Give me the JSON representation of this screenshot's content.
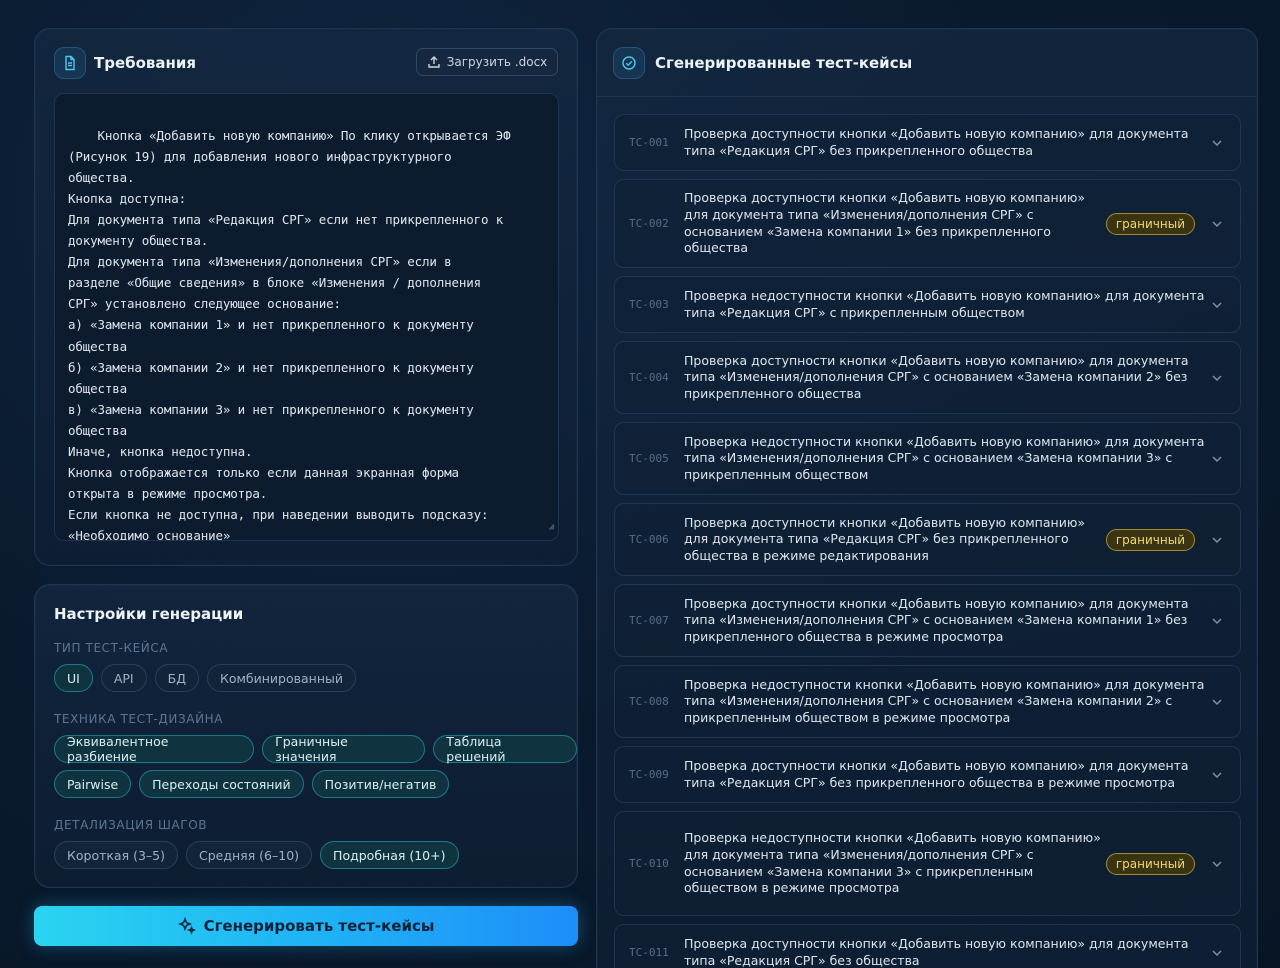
{
  "requirements": {
    "title": "Требования",
    "upload_label": "Загрузить .docx",
    "text": "Кнопка «Добавить новую компанию» По клику открывается ЭФ\n(Рисунок 19) для добавления нового инфраструктурного\nобщества.\nКнопка доступна:\nДля документа типа «Редакция СРГ» если нет прикрепленного к\nдокументу общества.\nДля документа типа «Изменения/дополнения СРГ» если в\nразделе «Общие сведения» в блоке «Изменения / дополнения\nСРГ» установлено следующее основание:\nа) «Замена компании 1» и нет прикрепленного к документу\nобщества\nб) «Замена компании 2» и нет прикрепленного к документу\nобщества\nв) «Замена компании 3» и нет прикрепленного к документу\nобщества\nИначе, кнопка недоступна.\nКнопка отображается только если данная экранная форма\nоткрыта в режиме просмотра.\nЕсли кнопка не доступна, при наведении выводить подсказу:\n«Необходимо основание»"
  },
  "settings": {
    "title": "Настройки генерации",
    "type_label": "ТИП ТЕСТ-КЕЙСА",
    "types": [
      {
        "label": "UI",
        "active": true
      },
      {
        "label": "API",
        "active": false
      },
      {
        "label": "БД",
        "active": false
      },
      {
        "label": "Комбинированный",
        "active": false
      }
    ],
    "technique_label": "ТЕХНИКА ТЕСТ-ДИЗАЙНА",
    "techniques_row1": [
      {
        "label": "Эквивалентное разбиение",
        "active": true
      },
      {
        "label": "Граничные значения",
        "active": true
      },
      {
        "label": "Таблица решений",
        "active": true
      }
    ],
    "techniques_row2": [
      {
        "label": "Pairwise",
        "active": true
      },
      {
        "label": "Переходы состояний",
        "active": true
      },
      {
        "label": "Позитив/негатив",
        "active": true
      }
    ],
    "detail_label": "ДЕТАЛИЗАЦИЯ ШАГОВ",
    "details": [
      {
        "label": "Короткая (3–5)",
        "active": false
      },
      {
        "label": "Средняя (6–10)",
        "active": false
      },
      {
        "label": "Подробная (10+)",
        "active": true
      }
    ]
  },
  "generate_label": "Сгенерировать тест-кейсы",
  "results": {
    "title": "Сгенерированные тест-кейсы",
    "badge_color": "#f2d86a",
    "accent_color": "#1fb4f5",
    "cases": [
      {
        "id": "TC-001",
        "lines": [
          "Проверка доступности кнопки «Добавить новую компанию» для документа",
          "типа «Редакция СРГ» без прикрепленного общества"
        ],
        "badge": ""
      },
      {
        "id": "TC-002",
        "lines": [
          "Проверка доступности кнопки «Добавить новую компанию»",
          "для документа типа «Изменения/дополнения СРГ» с",
          "основанием «Замена компании 1» без прикрепленного",
          "общества"
        ],
        "badge": "граничный"
      },
      {
        "id": "TC-003",
        "lines": [
          "Проверка недоступности кнопки «Добавить новую компанию» для документа",
          "типа «Редакция СРГ» с прикрепленным обществом"
        ],
        "badge": ""
      },
      {
        "id": "TC-004",
        "lines": [
          "Проверка доступности кнопки «Добавить новую компанию» для документа",
          "типа «Изменения/дополнения СРГ» с основанием «Замена компании 2» без",
          "прикрепленного общества"
        ],
        "badge": ""
      },
      {
        "id": "TC-005",
        "lines": [
          "Проверка недоступности кнопки «Добавить новую компанию» для документа",
          "типа «Изменения/дополнения СРГ» с основанием «Замена компании 3» с",
          "прикрепленным обществом"
        ],
        "badge": ""
      },
      {
        "id": "TC-006",
        "lines": [
          "Проверка доступности кнопки «Добавить новую компанию»",
          "для документа типа «Редакция СРГ» без прикрепленного",
          "общества в режиме редактирования"
        ],
        "badge": "граничный"
      },
      {
        "id": "TC-007",
        "lines": [
          "Проверка доступности кнопки «Добавить новую компанию» для документа",
          "типа «Изменения/дополнения СРГ» с основанием «Замена компании 1» без",
          "прикрепленного общества в режиме просмотра"
        ],
        "badge": ""
      },
      {
        "id": "TC-008",
        "lines": [
          "Проверка недоступности кнопки «Добавить новую компанию» для документа",
          "типа «Изменения/дополнения СРГ» с основанием «Замена компании 2» с",
          "прикрепленным обществом в режиме просмотра"
        ],
        "badge": ""
      },
      {
        "id": "TC-009",
        "lines": [
          "Проверка доступности кнопки «Добавить новую компанию» для документа",
          "типа «Редакция СРГ» без прикрепленного общества в режиме просмотра"
        ],
        "badge": ""
      },
      {
        "id": "TC-010",
        "lines": [
          "Проверка недоступности кнопки «Добавить новую компанию»",
          "для документа типа «Изменения/дополнения СРГ» с",
          "основанием «Замена компании 3» с прикрепленным",
          "обществом в режиме просмотра"
        ],
        "badge": "граничный"
      },
      {
        "id": "TC-011",
        "lines": [
          "Проверка доступности кнопки «Добавить новую компанию» для документа",
          "типа «Редакция СРГ» без общества"
        ],
        "badge": ""
      }
    ]
  }
}
